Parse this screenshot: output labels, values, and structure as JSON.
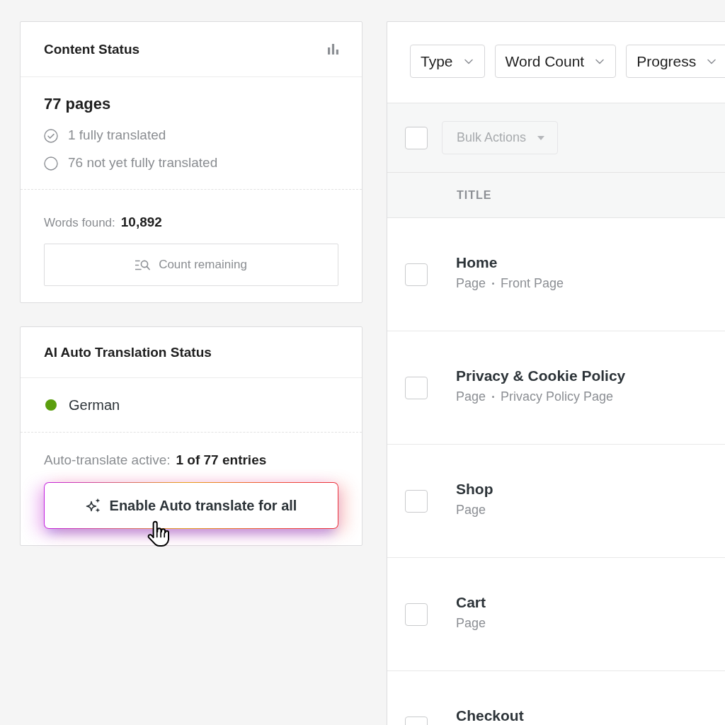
{
  "content_status": {
    "title": "Content Status",
    "summary": "77 pages",
    "stats": [
      {
        "kind": "done",
        "label": "1 fully translated"
      },
      {
        "kind": "pending",
        "label": "76 not yet fully translated"
      }
    ],
    "words_label": "Words found:",
    "words_value": "10,892",
    "button": "Count remaining"
  },
  "auto_translation_status": {
    "title": "AI Auto Translation Status",
    "languages": [
      {
        "name": "German",
        "color": "#5a9e0d"
      }
    ],
    "active_label": "Auto-translate active:",
    "active_value": "1 of 77 entries",
    "button": "Enable Auto translate for all"
  },
  "filters": [
    {
      "label": "Type"
    },
    {
      "label": "Word Count"
    },
    {
      "label": "Progress"
    }
  ],
  "bulk_actions": {
    "select_all": {
      "checked": false
    },
    "label": "Bulk Actions",
    "disabled": true
  },
  "table": {
    "columns": [
      "TITLE"
    ],
    "rows": [
      {
        "title": "Home",
        "meta": [
          "Page",
          "Front Page"
        ],
        "checked": false
      },
      {
        "title": "Privacy & Cookie Policy",
        "meta": [
          "Page",
          "Privacy Policy Page"
        ],
        "checked": false
      },
      {
        "title": "Shop",
        "meta": [
          "Page"
        ],
        "checked": false
      },
      {
        "title": "Cart",
        "meta": [
          "Page"
        ],
        "checked": false
      },
      {
        "title": "Checkout",
        "checked": false
      }
    ]
  }
}
